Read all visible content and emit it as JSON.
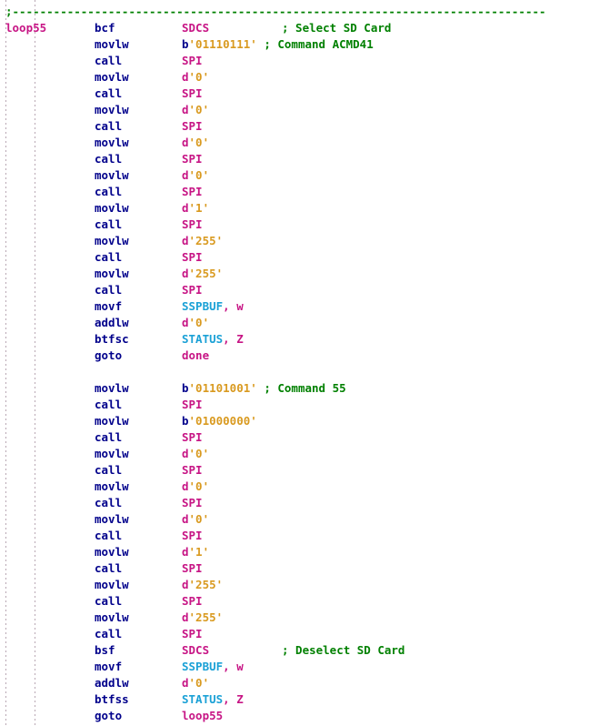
{
  "editor": {
    "name": "assembly-code-view",
    "language": "PIC Assembly",
    "background_color": "#ffffff",
    "colors": {
      "comment": "#008000",
      "mnemonic": "#00008b",
      "label": "#c71585",
      "sfr_register": "#1ba1d6",
      "number_literal": "#d99a20",
      "indent_guide": "#b9a8b4"
    }
  },
  "lines": [
    {
      "type": "full_comment",
      "text": ";------------------------------------------------------------------------------"
    },
    {
      "type": "code",
      "label": "loop55",
      "mnemonic": "bcf",
      "operand_parts": [
        {
          "t": "sym",
          "v": "SDCS"
        }
      ],
      "comment": "; Select SD Card"
    },
    {
      "type": "code",
      "label": "",
      "mnemonic": "movlw",
      "operand_parts": [
        {
          "t": "radix_b",
          "v": "b"
        },
        {
          "t": "num",
          "v": "'01110111'"
        }
      ],
      "comment": "; Command ACMD41",
      "comment_inline": true
    },
    {
      "type": "code",
      "label": "",
      "mnemonic": "call",
      "operand_parts": [
        {
          "t": "sym",
          "v": "SPI"
        }
      ],
      "comment": ""
    },
    {
      "type": "code",
      "label": "",
      "mnemonic": "movlw",
      "operand_parts": [
        {
          "t": "radix_d",
          "v": "d"
        },
        {
          "t": "num",
          "v": "'0'"
        }
      ],
      "comment": ""
    },
    {
      "type": "code",
      "label": "",
      "mnemonic": "call",
      "operand_parts": [
        {
          "t": "sym",
          "v": "SPI"
        }
      ],
      "comment": ""
    },
    {
      "type": "code",
      "label": "",
      "mnemonic": "movlw",
      "operand_parts": [
        {
          "t": "radix_d",
          "v": "d"
        },
        {
          "t": "num",
          "v": "'0'"
        }
      ],
      "comment": ""
    },
    {
      "type": "code",
      "label": "",
      "mnemonic": "call",
      "operand_parts": [
        {
          "t": "sym",
          "v": "SPI"
        }
      ],
      "comment": ""
    },
    {
      "type": "code",
      "label": "",
      "mnemonic": "movlw",
      "operand_parts": [
        {
          "t": "radix_d",
          "v": "d"
        },
        {
          "t": "num",
          "v": "'0'"
        }
      ],
      "comment": ""
    },
    {
      "type": "code",
      "label": "",
      "mnemonic": "call",
      "operand_parts": [
        {
          "t": "sym",
          "v": "SPI"
        }
      ],
      "comment": ""
    },
    {
      "type": "code",
      "label": "",
      "mnemonic": "movlw",
      "operand_parts": [
        {
          "t": "radix_d",
          "v": "d"
        },
        {
          "t": "num",
          "v": "'0'"
        }
      ],
      "comment": ""
    },
    {
      "type": "code",
      "label": "",
      "mnemonic": "call",
      "operand_parts": [
        {
          "t": "sym",
          "v": "SPI"
        }
      ],
      "comment": ""
    },
    {
      "type": "code",
      "label": "",
      "mnemonic": "movlw",
      "operand_parts": [
        {
          "t": "radix_d",
          "v": "d"
        },
        {
          "t": "num",
          "v": "'1'"
        }
      ],
      "comment": ""
    },
    {
      "type": "code",
      "label": "",
      "mnemonic": "call",
      "operand_parts": [
        {
          "t": "sym",
          "v": "SPI"
        }
      ],
      "comment": ""
    },
    {
      "type": "code",
      "label": "",
      "mnemonic": "movlw",
      "operand_parts": [
        {
          "t": "radix_d",
          "v": "d"
        },
        {
          "t": "num",
          "v": "'255'"
        }
      ],
      "comment": ""
    },
    {
      "type": "code",
      "label": "",
      "mnemonic": "call",
      "operand_parts": [
        {
          "t": "sym",
          "v": "SPI"
        }
      ],
      "comment": ""
    },
    {
      "type": "code",
      "label": "",
      "mnemonic": "movlw",
      "operand_parts": [
        {
          "t": "radix_d",
          "v": "d"
        },
        {
          "t": "num",
          "v": "'255'"
        }
      ],
      "comment": ""
    },
    {
      "type": "code",
      "label": "",
      "mnemonic": "call",
      "operand_parts": [
        {
          "t": "sym",
          "v": "SPI"
        }
      ],
      "comment": ""
    },
    {
      "type": "code",
      "label": "",
      "mnemonic": "movf",
      "operand_parts": [
        {
          "t": "sfr",
          "v": "SSPBUF"
        },
        {
          "t": "sym",
          "v": ", w"
        }
      ],
      "comment": ""
    },
    {
      "type": "code",
      "label": "",
      "mnemonic": "addlw",
      "operand_parts": [
        {
          "t": "radix_d",
          "v": "d"
        },
        {
          "t": "num",
          "v": "'0'"
        }
      ],
      "comment": ""
    },
    {
      "type": "code",
      "label": "",
      "mnemonic": "btfsc",
      "operand_parts": [
        {
          "t": "sfr",
          "v": "STATUS"
        },
        {
          "t": "sym",
          "v": ", Z"
        }
      ],
      "comment": ""
    },
    {
      "type": "code",
      "label": "",
      "mnemonic": "goto",
      "operand_parts": [
        {
          "t": "sym",
          "v": "done"
        }
      ],
      "comment": ""
    },
    {
      "type": "blank"
    },
    {
      "type": "code",
      "label": "",
      "mnemonic": "movlw",
      "operand_parts": [
        {
          "t": "radix_b",
          "v": "b"
        },
        {
          "t": "num",
          "v": "'01101001'"
        }
      ],
      "comment": "; Command 55",
      "comment_inline": true
    },
    {
      "type": "code",
      "label": "",
      "mnemonic": "call",
      "operand_parts": [
        {
          "t": "sym",
          "v": "SPI"
        }
      ],
      "comment": ""
    },
    {
      "type": "code",
      "label": "",
      "mnemonic": "movlw",
      "operand_parts": [
        {
          "t": "radix_b",
          "v": "b"
        },
        {
          "t": "num",
          "v": "'01000000'"
        }
      ],
      "comment": ""
    },
    {
      "type": "code",
      "label": "",
      "mnemonic": "call",
      "operand_parts": [
        {
          "t": "sym",
          "v": "SPI"
        }
      ],
      "comment": ""
    },
    {
      "type": "code",
      "label": "",
      "mnemonic": "movlw",
      "operand_parts": [
        {
          "t": "radix_d",
          "v": "d"
        },
        {
          "t": "num",
          "v": "'0'"
        }
      ],
      "comment": ""
    },
    {
      "type": "code",
      "label": "",
      "mnemonic": "call",
      "operand_parts": [
        {
          "t": "sym",
          "v": "SPI"
        }
      ],
      "comment": ""
    },
    {
      "type": "code",
      "label": "",
      "mnemonic": "movlw",
      "operand_parts": [
        {
          "t": "radix_d",
          "v": "d"
        },
        {
          "t": "num",
          "v": "'0'"
        }
      ],
      "comment": ""
    },
    {
      "type": "code",
      "label": "",
      "mnemonic": "call",
      "operand_parts": [
        {
          "t": "sym",
          "v": "SPI"
        }
      ],
      "comment": ""
    },
    {
      "type": "code",
      "label": "",
      "mnemonic": "movlw",
      "operand_parts": [
        {
          "t": "radix_d",
          "v": "d"
        },
        {
          "t": "num",
          "v": "'0'"
        }
      ],
      "comment": ""
    },
    {
      "type": "code",
      "label": "",
      "mnemonic": "call",
      "operand_parts": [
        {
          "t": "sym",
          "v": "SPI"
        }
      ],
      "comment": ""
    },
    {
      "type": "code",
      "label": "",
      "mnemonic": "movlw",
      "operand_parts": [
        {
          "t": "radix_d",
          "v": "d"
        },
        {
          "t": "num",
          "v": "'1'"
        }
      ],
      "comment": ""
    },
    {
      "type": "code",
      "label": "",
      "mnemonic": "call",
      "operand_parts": [
        {
          "t": "sym",
          "v": "SPI"
        }
      ],
      "comment": ""
    },
    {
      "type": "code",
      "label": "",
      "mnemonic": "movlw",
      "operand_parts": [
        {
          "t": "radix_d",
          "v": "d"
        },
        {
          "t": "num",
          "v": "'255'"
        }
      ],
      "comment": ""
    },
    {
      "type": "code",
      "label": "",
      "mnemonic": "call",
      "operand_parts": [
        {
          "t": "sym",
          "v": "SPI"
        }
      ],
      "comment": ""
    },
    {
      "type": "code",
      "label": "",
      "mnemonic": "movlw",
      "operand_parts": [
        {
          "t": "radix_d",
          "v": "d"
        },
        {
          "t": "num",
          "v": "'255'"
        }
      ],
      "comment": ""
    },
    {
      "type": "code",
      "label": "",
      "mnemonic": "call",
      "operand_parts": [
        {
          "t": "sym",
          "v": "SPI"
        }
      ],
      "comment": ""
    },
    {
      "type": "code",
      "label": "",
      "mnemonic": "bsf",
      "operand_parts": [
        {
          "t": "sym",
          "v": "SDCS"
        }
      ],
      "comment": "; Deselect SD Card"
    },
    {
      "type": "code",
      "label": "",
      "mnemonic": "movf",
      "operand_parts": [
        {
          "t": "sfr",
          "v": "SSPBUF"
        },
        {
          "t": "sym",
          "v": ", w"
        }
      ],
      "comment": ""
    },
    {
      "type": "code",
      "label": "",
      "mnemonic": "addlw",
      "operand_parts": [
        {
          "t": "radix_d",
          "v": "d"
        },
        {
          "t": "num",
          "v": "'0'"
        }
      ],
      "comment": ""
    },
    {
      "type": "code",
      "label": "",
      "mnemonic": "btfss",
      "operand_parts": [
        {
          "t": "sfr",
          "v": "STATUS"
        },
        {
          "t": "sym",
          "v": ", Z"
        }
      ],
      "comment": ""
    },
    {
      "type": "code",
      "label": "",
      "mnemonic": "goto",
      "operand_parts": [
        {
          "t": "sym",
          "v": "loop55"
        }
      ],
      "comment": ""
    }
  ]
}
